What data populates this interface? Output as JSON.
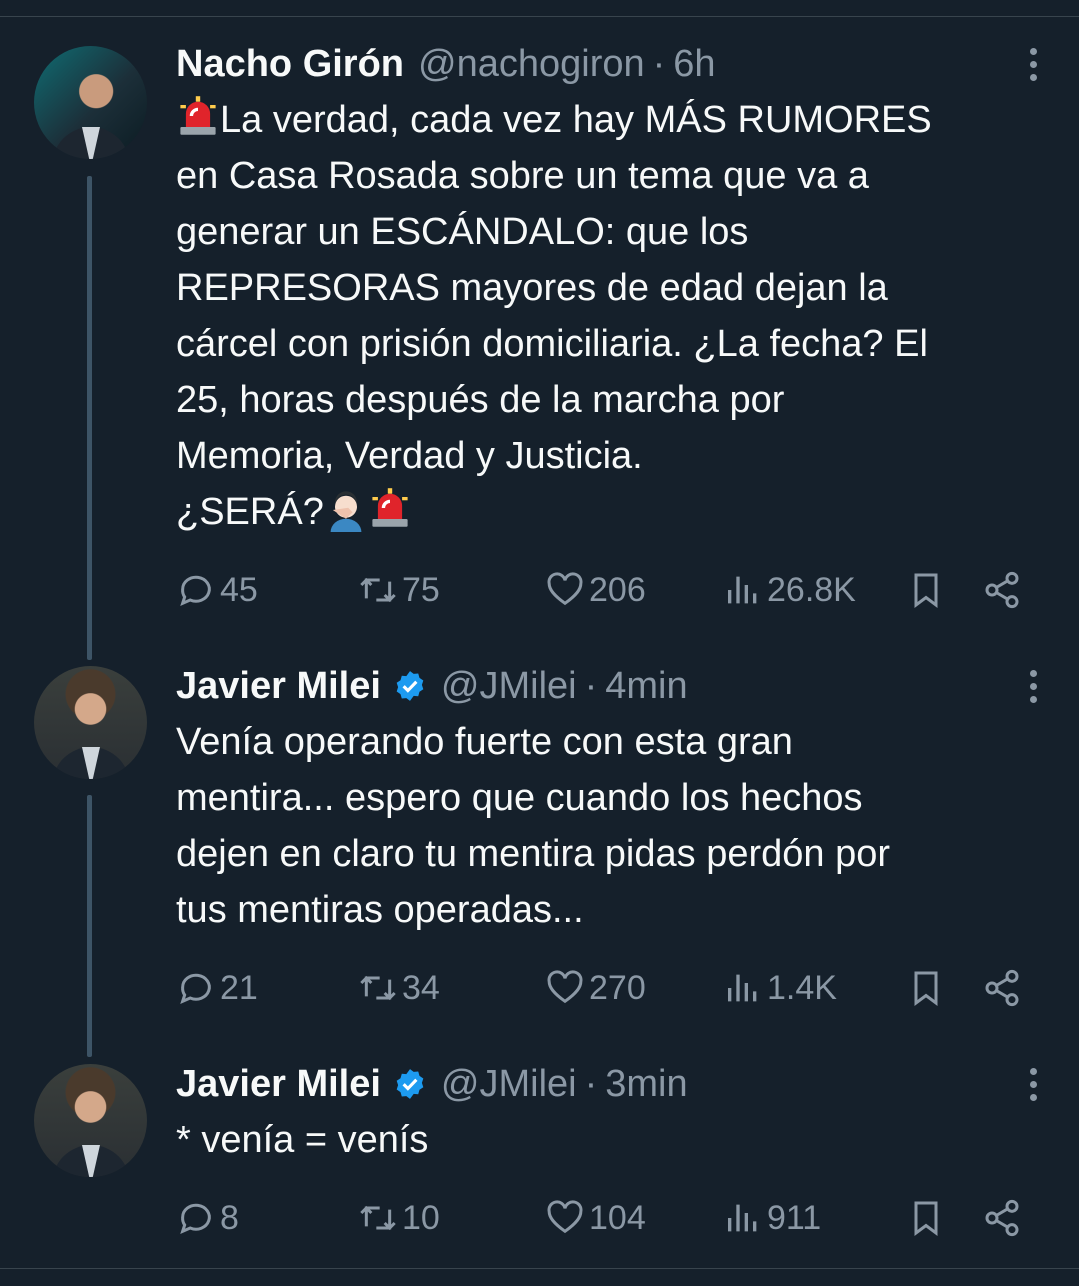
{
  "tweets": [
    {
      "name": "Nacho Girón",
      "handle": "@nachogiron",
      "time": "6h",
      "lines": [
        "La verdad, cada vez hay MÁS RUMORES",
        "en Casa Rosada sobre un tema que va a",
        "generar un ESCÁNDALO: que los",
        "REPRESORAS mayores de edad dejan la",
        "cárcel con prisión domiciliaria. ¿La fecha? El",
        "25, horas después de la marcha por",
        "Memoria, Verdad y Justicia.",
        "¿SERÁ?"
      ],
      "replies": "45",
      "retweets": "75",
      "likes": "206",
      "views": "26.8K"
    },
    {
      "name": "Javier Milei",
      "handle": "@JMilei",
      "time": "4min",
      "lines": [
        "Venía operando fuerte con esta gran",
        "mentira... espero que cuando los hechos",
        "dejen en claro tu mentira pidas perdón por",
        "tus mentiras operadas..."
      ],
      "replies": "21",
      "retweets": "34",
      "likes": "270",
      "views": "1.4K"
    },
    {
      "name": "Javier Milei",
      "handle": "@JMilei",
      "time": "3min",
      "lines": [
        "* venía = venís"
      ],
      "replies": "8",
      "retweets": "10",
      "likes": "104",
      "views": "911"
    }
  ],
  "separator": "·",
  "colors": {
    "background": "#15202b",
    "muted": "#8b98a5",
    "verified": "#1d9bf0",
    "thread_line": "#3d5466"
  },
  "icons": [
    "siren-emoji",
    "facepalm-emoji",
    "verified-badge-icon",
    "reply-icon",
    "retweet-icon",
    "like-icon",
    "views-icon",
    "bookmark-icon",
    "share-icon",
    "more-icon"
  ]
}
